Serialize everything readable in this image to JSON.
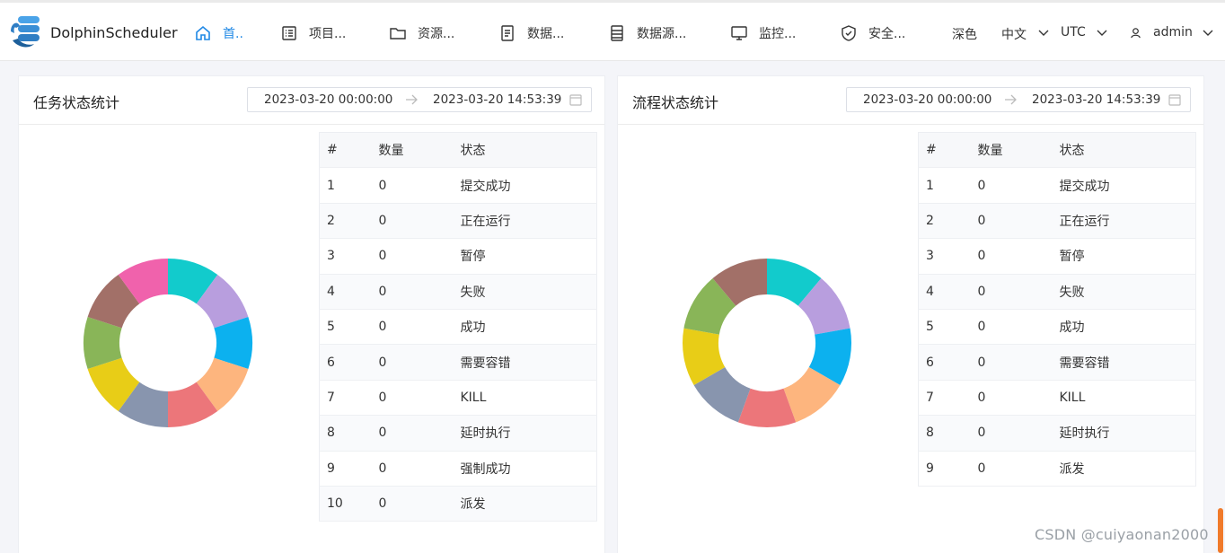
{
  "header": {
    "brand": "DolphinScheduler",
    "nav": [
      {
        "label": "首..",
        "icon": "home-icon",
        "active": true
      },
      {
        "label": "项目...",
        "icon": "list-icon"
      },
      {
        "label": "资源...",
        "icon": "folder-icon"
      },
      {
        "label": "数据...",
        "icon": "document-icon"
      },
      {
        "label": "数据源...",
        "icon": "database-icon"
      },
      {
        "label": "监控...",
        "icon": "monitor-icon"
      },
      {
        "label": "安全...",
        "icon": "shield-icon"
      }
    ],
    "theme": "深色",
    "language": "中文",
    "timezone": "UTC",
    "user": "admin"
  },
  "task_panel": {
    "title": "任务状态统计",
    "range_start": "2023-03-20 00:00:00",
    "range_end": "2023-03-20 14:53:39",
    "columns": [
      "#",
      "数量",
      "状态"
    ],
    "rows": [
      [
        "1",
        "0",
        "提交成功"
      ],
      [
        "2",
        "0",
        "正在运行"
      ],
      [
        "3",
        "0",
        "暂停"
      ],
      [
        "4",
        "0",
        "失败"
      ],
      [
        "5",
        "0",
        "成功"
      ],
      [
        "6",
        "0",
        "需要容错"
      ],
      [
        "7",
        "0",
        "KILL"
      ],
      [
        "8",
        "0",
        "延时执行"
      ],
      [
        "9",
        "0",
        "强制成功"
      ],
      [
        "10",
        "0",
        "派发"
      ]
    ]
  },
  "process_panel": {
    "title": "流程状态统计",
    "range_start": "2023-03-20 00:00:00",
    "range_end": "2023-03-20 14:53:39",
    "columns": [
      "#",
      "数量",
      "状态"
    ],
    "rows": [
      [
        "1",
        "0",
        "提交成功"
      ],
      [
        "2",
        "0",
        "正在运行"
      ],
      [
        "3",
        "0",
        "暂停"
      ],
      [
        "4",
        "0",
        "失败"
      ],
      [
        "5",
        "0",
        "成功"
      ],
      [
        "6",
        "0",
        "需要容错"
      ],
      [
        "7",
        "0",
        "KILL"
      ],
      [
        "8",
        "0",
        "延时执行"
      ],
      [
        "9",
        "0",
        "派发"
      ]
    ]
  },
  "chart_data": [
    {
      "type": "pie",
      "categories": [
        "提交成功",
        "正在运行",
        "暂停",
        "失败",
        "成功",
        "需要容错",
        "KILL",
        "延时执行",
        "强制成功",
        "派发"
      ],
      "values": [
        0,
        0,
        0,
        0,
        0,
        0,
        0,
        0,
        0,
        0
      ],
      "colors": [
        "#12cbcc",
        "#b89ede",
        "#0cb1ef",
        "#fdb57e",
        "#ec767a",
        "#8895ae",
        "#e8cd17",
        "#89b558",
        "#a27068",
        "#f062ac"
      ],
      "donut": true
    },
    {
      "type": "pie",
      "categories": [
        "提交成功",
        "正在运行",
        "暂停",
        "失败",
        "成功",
        "需要容错",
        "KILL",
        "延时执行",
        "派发"
      ],
      "values": [
        0,
        0,
        0,
        0,
        0,
        0,
        0,
        0,
        0
      ],
      "colors": [
        "#12cbcc",
        "#b89ede",
        "#0cb1ef",
        "#fdb57e",
        "#ec767a",
        "#8895ae",
        "#e8cd17",
        "#89b558",
        "#a27068"
      ],
      "donut": true
    }
  ],
  "watermark": "CSDN @cuiyaonan2000"
}
